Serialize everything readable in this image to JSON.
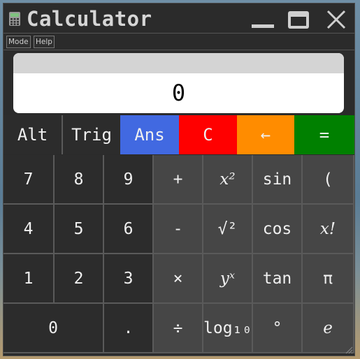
{
  "window": {
    "title": "Calculator",
    "controls": [
      "minimize-icon",
      "maximize-icon",
      "close-icon"
    ]
  },
  "menu": {
    "items": [
      "Mode",
      "Help"
    ]
  },
  "display": {
    "expression": "",
    "value": "0"
  },
  "function_row": [
    {
      "label": "Alt",
      "color": "#2c2c2c"
    },
    {
      "label": "Trig",
      "color": "#2c2c2c"
    },
    {
      "label": "Ans",
      "color": "#4169e1"
    },
    {
      "label": "C",
      "color": "#ff0000"
    },
    {
      "label": "←",
      "color": "#ff8c00"
    },
    {
      "label": "=",
      "color": "#008000"
    }
  ],
  "keypad": {
    "row1": [
      "7",
      "8",
      "9",
      "+",
      "x²",
      "sin",
      "("
    ],
    "row2": [
      "4",
      "5",
      "6",
      "-",
      "√²",
      "cos",
      "x!"
    ],
    "row3": [
      "1",
      "2",
      "3",
      "×",
      "yˣ",
      "tan",
      "π"
    ],
    "row4": [
      "0",
      ".",
      "÷",
      "log₁₀",
      "°",
      "e"
    ]
  },
  "colors": {
    "window_bg": "#2b2b2b",
    "digit_key_bg": "#2c2c2c",
    "op_key_bg": "#464646",
    "title_text": "#d6d6d6"
  }
}
